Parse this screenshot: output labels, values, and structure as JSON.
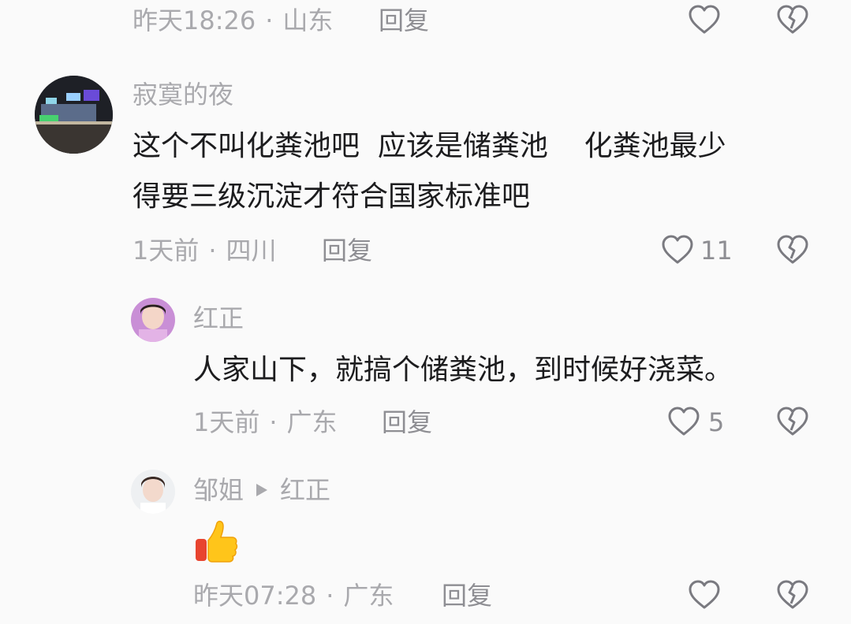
{
  "colors": {
    "bg": "#fafafa",
    "text": "#1c1c1e",
    "meta": "#a9a9ad",
    "icon": "#7a7a80"
  },
  "comments": [
    {
      "time": "昨天18:26",
      "sep": "·",
      "location": "山东",
      "reply_label": "回复",
      "like_icon": "heart-outline-icon",
      "dislike_icon": "broken-heart-icon"
    },
    {
      "author": "寂寞的夜",
      "line1": "这个不叫化粪池吧  应该是储粪池    化粪池最少",
      "line2": "得要三级沉淀才符合国家标准吧",
      "time": "1天前",
      "sep": "·",
      "location": "四川",
      "reply_label": "回复",
      "like_count": "11",
      "like_icon": "heart-outline-icon",
      "dislike_icon": "broken-heart-icon"
    },
    {
      "author": "红正",
      "line1": "人家山下，就搞个储粪池，到时候好浇菜。",
      "time": "1天前",
      "sep": "·",
      "location": "广东",
      "reply_label": "回复",
      "like_count": "5",
      "like_icon": "heart-outline-icon",
      "dislike_icon": "broken-heart-icon"
    },
    {
      "author": "邹姐",
      "reply_to": "红正",
      "reply_arrow_icon": "play-triangle-icon",
      "content_icon": "thumbs-up-emoji-icon",
      "time": "昨天07:28",
      "sep": "·",
      "location": "广东",
      "reply_label": "回复",
      "like_icon": "heart-outline-icon",
      "dislike_icon": "broken-heart-icon"
    }
  ]
}
